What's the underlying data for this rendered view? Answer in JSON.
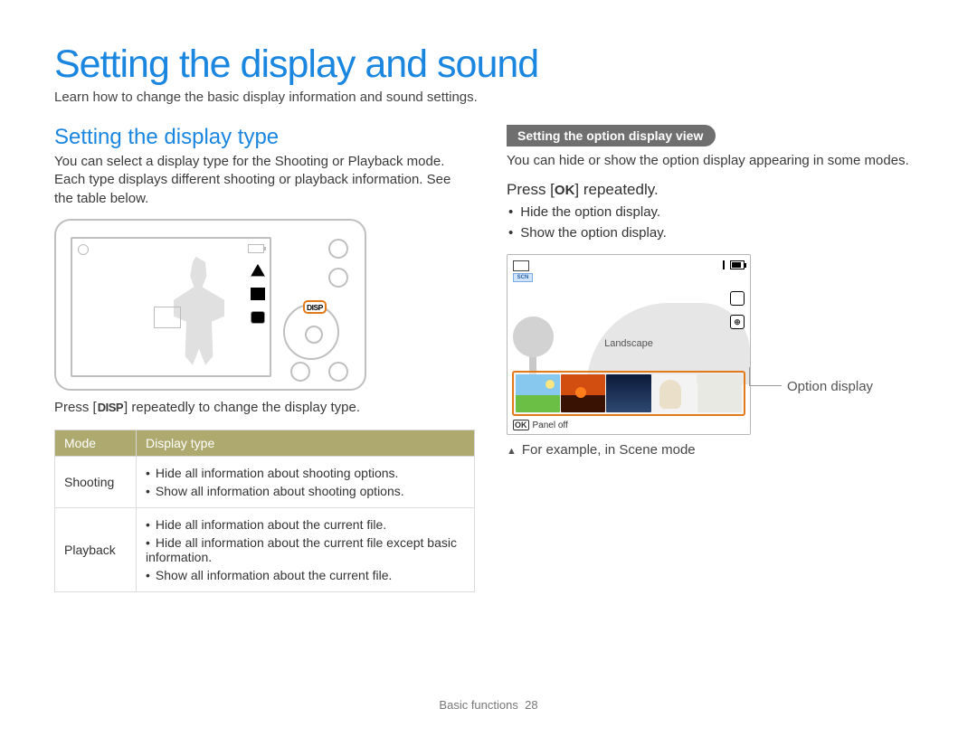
{
  "page": {
    "title": "Setting the display and sound",
    "intro": "Learn how to change the basic display information and sound settings."
  },
  "left": {
    "heading": "Setting the display type",
    "p1": "You can select a display type for the Shooting or Playback mode. Each type displays different shooting or playback information. See the table below.",
    "disp_badge": "DISP",
    "instr_pre": "Press [",
    "instr_key": "DISP",
    "instr_post": "] repeatedly to change the display type.",
    "table": {
      "headers": {
        "mode": "Mode",
        "type": "Display type"
      },
      "rows": [
        {
          "mode": "Shooting",
          "items": [
            "Hide all information about shooting options.",
            "Show all information about shooting options."
          ]
        },
        {
          "mode": "Playback",
          "items": [
            "Hide all information about the current file.",
            "Hide all information about the current file except basic information.",
            "Show all information about the current file."
          ]
        }
      ]
    }
  },
  "right": {
    "pill": "Setting the option display view",
    "p1": "You can hide or show the option display appearing in some modes.",
    "press_pre": "Press [",
    "press_key": "OK",
    "press_post": "] repeatedly.",
    "bullets": [
      "Hide the option display.",
      "Show the option display."
    ],
    "scene": {
      "scn_label": "SCN",
      "label": "Landscape",
      "panel_off_key": "OK",
      "panel_off": "Panel off",
      "callout": "Option display",
      "note": "For example, in Scene mode"
    }
  },
  "footer": {
    "section": "Basic functions",
    "page_num": "28"
  }
}
